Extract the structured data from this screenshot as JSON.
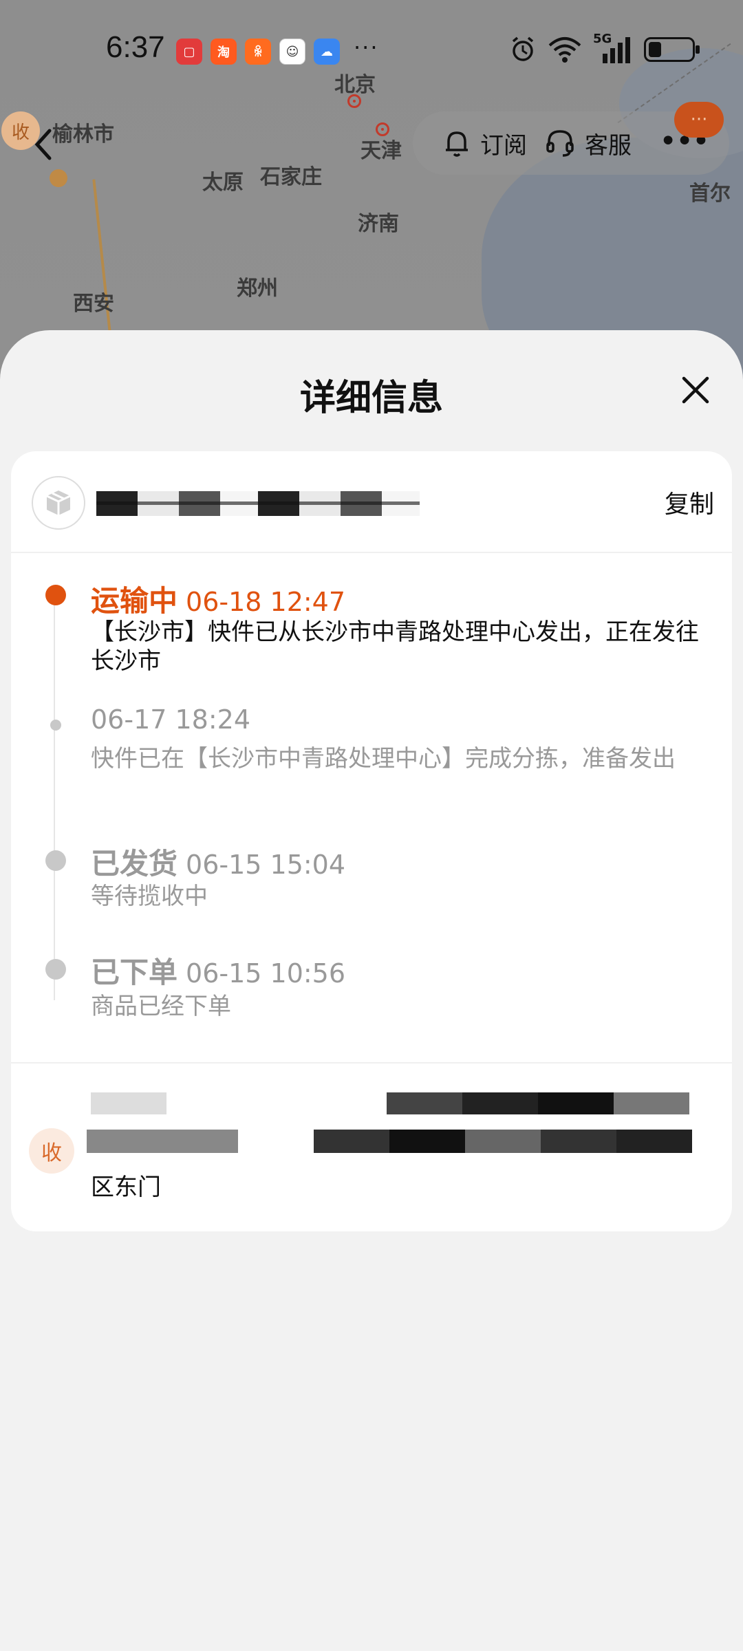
{
  "status_bar": {
    "time": "6:37",
    "more": "···",
    "network": "5G"
  },
  "map": {
    "cities": [
      "北京",
      "天津",
      "太原",
      "石家庄",
      "济南",
      "郑州",
      "西安",
      "榆林市",
      "首尔"
    ],
    "badge": "收"
  },
  "header": {
    "subscribe_label": "订阅",
    "service_label": "客服",
    "chat_bubble": "···"
  },
  "sheet": {
    "title": "详细信息",
    "copy_label": "复制",
    "events": [
      {
        "status": "运输中",
        "time": "06-18 12:47",
        "desc": "【长沙市】快件已从长沙市中青路处理中心发出，正在发往长沙市"
      },
      {
        "status": "",
        "time": "06-17 18:24",
        "desc": "快件已在【长沙市中青路处理中心】完成分拣，准备发出"
      },
      {
        "status": "已发货",
        "time": "06-15 15:04",
        "desc": "等待揽收中"
      },
      {
        "status": "已下单",
        "time": "06-15 10:56",
        "desc": "商品已经下单"
      }
    ],
    "receiver_badge": "收",
    "address_tail": "区东门"
  },
  "colors": {
    "accent": "#e0520f",
    "muted": "#999999"
  }
}
